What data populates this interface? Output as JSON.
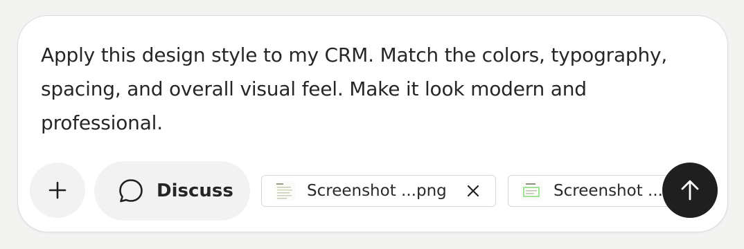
{
  "composer": {
    "prompt_text": "Apply this design style to my CRM. Match the colors, typography, spacing, and overall visual feel. Make it look modern and professional."
  },
  "toolbar": {
    "add_icon": "plus-icon",
    "discuss_label": "Discuss",
    "discuss_icon": "speech-bubble-icon",
    "send_icon": "arrow-up-icon"
  },
  "attachments": [
    {
      "name": "Screenshot ...png",
      "icon": "image-thumbnail-icon"
    },
    {
      "name": "Screenshot ...",
      "icon": "image-thumbnail-icon"
    }
  ],
  "colors": {
    "background": "#f3f3f2",
    "card": "#ffffff",
    "text": "#262626",
    "pill": "#f2f2f2",
    "send_button": "#1f1f1f"
  }
}
